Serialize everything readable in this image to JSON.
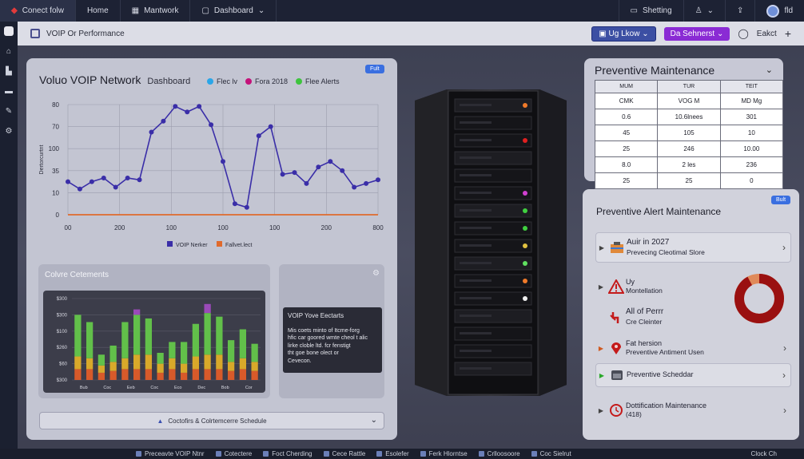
{
  "topnav": {
    "tabs": [
      {
        "label": "Conect folw",
        "icon": "brand-icon"
      },
      {
        "label": "Home",
        "icon": ""
      },
      {
        "label": "Mantwork",
        "icon": "grid-icon"
      },
      {
        "label": "Dashboard",
        "icon": "lock-icon"
      }
    ],
    "right": [
      {
        "label": "Shetting",
        "icon": "monitor-icon"
      },
      {
        "label": "",
        "icon": "user-icon"
      },
      {
        "label": "",
        "icon": "upload-icon"
      },
      {
        "label": "fld",
        "icon": "avatar"
      }
    ]
  },
  "subbar": {
    "title": "VOIP Or Performance",
    "dropdown_label": "Ug Lkow",
    "purple_label": "Da Sehnerst",
    "extra_label": "Eakct"
  },
  "main": {
    "title": "Voluo VOIP Network",
    "subtitle": "Dashboard",
    "badge": "Fult",
    "legend": [
      {
        "label": "Flec lv",
        "color": "#2ba6e8"
      },
      {
        "label": "Fora 2018",
        "color": "#c4127a"
      },
      {
        "label": "Flee Alerts",
        "color": "#3ec43e"
      }
    ],
    "subpanel_left_title": "Colvre Cetements",
    "tooltip_title": "VOIP Yove Eectarts",
    "tooltip_lines": [
      "Mis coets minto of Itcme-forg",
      "hfic car goored wmte cheol t alic",
      "lirke cloble ltd. fcr fenstigt",
      "tht goe bone olect or",
      "Cevecon."
    ],
    "schedule_label": "Coctofirs & Colrtemcerre Schedule"
  },
  "chart_data": [
    {
      "type": "line",
      "ylabel": "Dertorcurtnt",
      "y_ticks": [
        "80",
        "70",
        "100",
        "35",
        "10",
        "0"
      ],
      "x_ticks": [
        "00",
        "200",
        "100",
        "100",
        "100",
        "200",
        "800"
      ],
      "legend_bottom": [
        "VOIP Nerker",
        "Fallvet.lect"
      ],
      "series": [
        {
          "name": "VOIP Nerker",
          "color": "#3a2ea8",
          "values": [
            18,
            14,
            18,
            20,
            15,
            20,
            19,
            45,
            51,
            59,
            56,
            59,
            49,
            29,
            6,
            4,
            43,
            48,
            22,
            23,
            17,
            26,
            29,
            24,
            15,
            17,
            19
          ]
        },
        {
          "name": "Fallvet.lect",
          "color": "#e06a2c",
          "values": [
            0,
            0,
            0,
            0,
            0,
            0,
            0,
            0,
            0,
            0,
            0,
            0,
            0,
            0,
            0,
            0,
            0,
            0,
            0,
            0,
            0,
            0,
            0,
            0,
            0,
            0,
            0
          ]
        }
      ]
    },
    {
      "type": "bar",
      "stacked": true,
      "y_ticks": [
        "$300",
        "$300",
        "$100",
        "$260",
        "$60",
        "$300"
      ],
      "x_ticks": [
        "Bub",
        "Coc",
        "Eeb",
        "Coc",
        "Eco",
        "Dec",
        "Bob",
        "Cor"
      ],
      "categories": [
        "1",
        "2",
        "3",
        "4",
        "5",
        "6",
        "7",
        "8",
        "9",
        "10",
        "11",
        "12",
        "13",
        "14",
        "15",
        "16"
      ],
      "series": [
        {
          "name": "red",
          "color": "#d85a2a",
          "values": [
            6,
            6,
            4,
            5,
            6,
            6,
            6,
            4,
            6,
            4,
            6,
            6,
            6,
            5,
            6,
            5
          ]
        },
        {
          "name": "yellow",
          "color": "#d8a92a",
          "values": [
            7,
            6,
            4,
            5,
            6,
            8,
            8,
            5,
            6,
            5,
            7,
            8,
            8,
            5,
            6,
            5
          ]
        },
        {
          "name": "green",
          "color": "#62c04a",
          "values": [
            23,
            20,
            6,
            9,
            20,
            22,
            20,
            6,
            9,
            12,
            18,
            23,
            21,
            12,
            16,
            10
          ]
        },
        {
          "name": "purple",
          "color": "#9a4ab8",
          "values": [
            0,
            0,
            0,
            0,
            0,
            3,
            0,
            0,
            0,
            0,
            0,
            5,
            0,
            0,
            0,
            0
          ]
        }
      ]
    }
  ],
  "preventive": {
    "title": "Preventive Maintenance",
    "headers": [
      "MUM",
      "TUR",
      "TEIT"
    ],
    "rows": [
      [
        "CMK",
        "VOG M",
        "MD Mg"
      ],
      [
        "0.6",
        "10.6lnees",
        "301"
      ],
      [
        "45",
        "105",
        "10"
      ],
      [
        "25",
        "246",
        "10.00"
      ],
      [
        "8.0",
        "2 les",
        "236"
      ],
      [
        "25",
        "25",
        "0"
      ]
    ]
  },
  "alerts": {
    "title": "Preventive Alert Maintenance",
    "badge": "Bult",
    "items": [
      {
        "line1": "Auir in 2027",
        "line2": "Prevecing Cleotimal Slore"
      },
      {
        "line1": "Uy",
        "line2": "Montellation"
      },
      {
        "line1": "All of Perrr",
        "line2": "Cre Cleinter"
      },
      {
        "line1": "Fat hersion",
        "line2": "Preventive Antiment Usen"
      },
      {
        "line1": "Preventive Scheddar",
        "line2": ""
      },
      {
        "line1": "Dottification Maintenance",
        "line2": "(418)"
      }
    ],
    "donut_fraction": 0.92
  },
  "taskbar": {
    "items": [
      "Preceavte VOIP Ntnr",
      "Cotectere",
      "Foct Cherding",
      "Cece Rattle",
      "Esolefer",
      "Ferk Hlorntse",
      "Crlloosoore",
      "Coc Sielrut"
    ],
    "end": "Clock Ch"
  }
}
